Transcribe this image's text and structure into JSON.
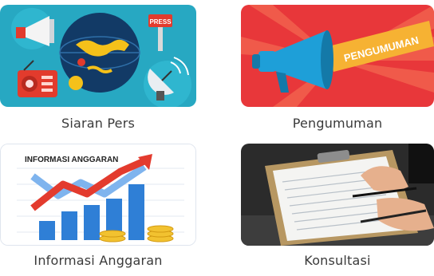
{
  "tiles": [
    {
      "label": "Siaran Pers",
      "image_text": "PRESS",
      "icon": "press-release-illustration"
    },
    {
      "label": "Pengumuman",
      "image_text": "PENGUMUMAN",
      "icon": "megaphone-announcement-illustration"
    },
    {
      "label": "Informasi Anggaran",
      "image_text": "INFORMASI ANGGARAN",
      "icon": "budget-growth-chart-illustration"
    },
    {
      "label": "Konsultasi",
      "icon": "consultation-clipboard-photo"
    }
  ],
  "colors": {
    "siaran_bg": "#27a8c2",
    "pengumuman_bg": "#e8373a",
    "anggaran_arrow_up": "#e33b2e",
    "anggaran_arrow_down": "#4a90e2",
    "caption_text": "#3a3a3a"
  }
}
